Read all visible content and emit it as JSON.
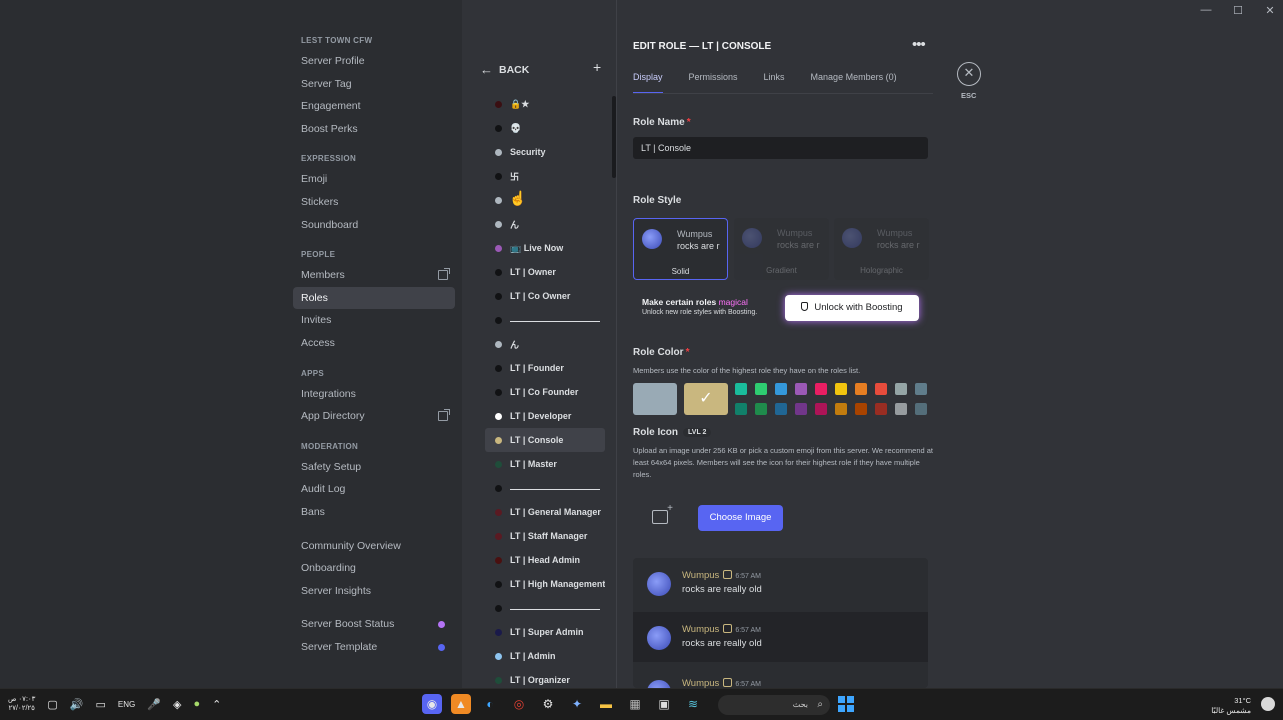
{
  "window": {
    "controls": [
      "—",
      "☐",
      "✕"
    ]
  },
  "sidebar": {
    "server_header": "LEST TOWN CFW",
    "groups": [
      {
        "items": [
          "Server Profile",
          "Server Tag",
          "Engagement",
          "Boost Perks"
        ]
      },
      {
        "header": "EXPRESSION",
        "items": [
          "Emoji",
          "Stickers",
          "Soundboard"
        ]
      },
      {
        "header": "PEOPLE",
        "items": [
          "Members",
          "Roles",
          "Invites",
          "Access"
        ]
      },
      {
        "header": "APPS",
        "items": [
          "Integrations",
          "App Directory"
        ]
      },
      {
        "header": "MODERATION",
        "items": [
          "Safety Setup",
          "Audit Log",
          "Bans"
        ]
      },
      {
        "items": [
          "Community Overview",
          "Onboarding",
          "Server Insights"
        ]
      },
      {
        "items": [
          "Server Boost Status",
          "Server Template"
        ]
      }
    ]
  },
  "role_list": {
    "back_label": "BACK",
    "roles": [
      {
        "name": "🔒★",
        "color": "#3a0f12"
      },
      {
        "name": "💀",
        "color": "#111214"
      },
      {
        "name": "Security",
        "color": "#aeb7bf"
      },
      {
        "name": "卐",
        "color": "#111214"
      },
      {
        "name": "",
        "color": "#aeb7bf"
      },
      {
        "name": "ん",
        "color": "#aeb7bf"
      },
      {
        "name": "📺 Live Now",
        "color": "#9b59b6"
      },
      {
        "name": "LT | Owner",
        "color": "#111214"
      },
      {
        "name": "LT | Co Owner",
        "color": "#111214"
      },
      {
        "name": "—",
        "color": "#111214",
        "separator": true
      },
      {
        "name": "ん",
        "color": "#aeb7bf"
      },
      {
        "name": "LT | Founder",
        "color": "#111214"
      },
      {
        "name": "LT | Co Founder",
        "color": "#111214"
      },
      {
        "name": "LT | Developer",
        "color": "#ffffff"
      },
      {
        "name": "LT | Console",
        "color": "#c9b77f",
        "selected": true
      },
      {
        "name": "LT | Master",
        "color": "#1f4d3a"
      },
      {
        "name": "—",
        "color": "#111214",
        "separator": true
      },
      {
        "name": "LT | General Manager",
        "color": "#5a1a22"
      },
      {
        "name": "LT | Staff Manager",
        "color": "#5a1a22"
      },
      {
        "name": "LT | Head Admin",
        "color": "#4a1010"
      },
      {
        "name": "LT | High Management",
        "color": "#111214"
      },
      {
        "name": "—",
        "color": "#111214",
        "separator": true
      },
      {
        "name": "LT | Super Admin",
        "color": "#1a1a4a"
      },
      {
        "name": "LT | Admin",
        "color": "#8ec5f0"
      },
      {
        "name": "LT | Organizer",
        "color": "#1f4d3a"
      }
    ]
  },
  "edit": {
    "title": "EDIT ROLE — LT | CONSOLE",
    "tabs": [
      "Display",
      "Permissions",
      "Links",
      "Manage Members (0)"
    ],
    "esc_label": "ESC",
    "role_name_label": "Role Name",
    "role_name_value": "LT | Console",
    "role_style_label": "Role Style",
    "style_cards": [
      {
        "name": "Wumpus",
        "text": "rocks are r",
        "caption": "Solid"
      },
      {
        "name": "Wumpus",
        "text": "rocks are r",
        "caption": "Gradient"
      },
      {
        "name": "Wumpus",
        "text": "rocks are r",
        "caption": "Holographic"
      }
    ],
    "boost": {
      "line1": "Make certain roles",
      "line1_magic": "magical",
      "line2": "Unlock new role styles with Boosting.",
      "button": "Unlock with Boosting"
    },
    "role_color_label": "Role Color",
    "role_color_desc": "Members use the color of the highest role they have on the roles list.",
    "colors": {
      "default": "#99aab5",
      "selected": "#c9b77f",
      "palette_top": [
        "#1abc9c",
        "#2ecc71",
        "#3498db",
        "#9b59b6",
        "#e91e63",
        "#f1c40f",
        "#e67e22",
        "#e74c3c",
        "#95a5a6",
        "#607d8b"
      ],
      "palette_bottom": [
        "#11806a",
        "#1f8b4c",
        "#206694",
        "#71368a",
        "#ad1457",
        "#c27c0e",
        "#a84300",
        "#992d22",
        "#979c9f",
        "#546e7a"
      ]
    },
    "role_icon_label": "Role Icon",
    "role_icon_badge": "LVL 2",
    "role_icon_desc": "Upload an image under 256 KB or pick a custom emoji from this server. We recommend at least 64x64 pixels. Members will see the icon for their highest role if they have multiple roles.",
    "choose_image": "Choose Image",
    "preview_messages": [
      {
        "name": "Wumpus",
        "time": "6:57 AM",
        "text": "rocks are really old"
      },
      {
        "name": "Wumpus",
        "time": "6:57 AM",
        "text": "rocks are really old"
      },
      {
        "name": "Wumpus",
        "time": "6:57 AM",
        "text": ""
      }
    ]
  },
  "taskbar": {
    "clock_time": "٠٧:٠٣ ص",
    "clock_date": "٢٧/٠٢/٢٥",
    "lang": "ENG",
    "search_text": "بحث",
    "weather_temp": "31°C",
    "weather_desc": "مشمس غالبًا"
  }
}
